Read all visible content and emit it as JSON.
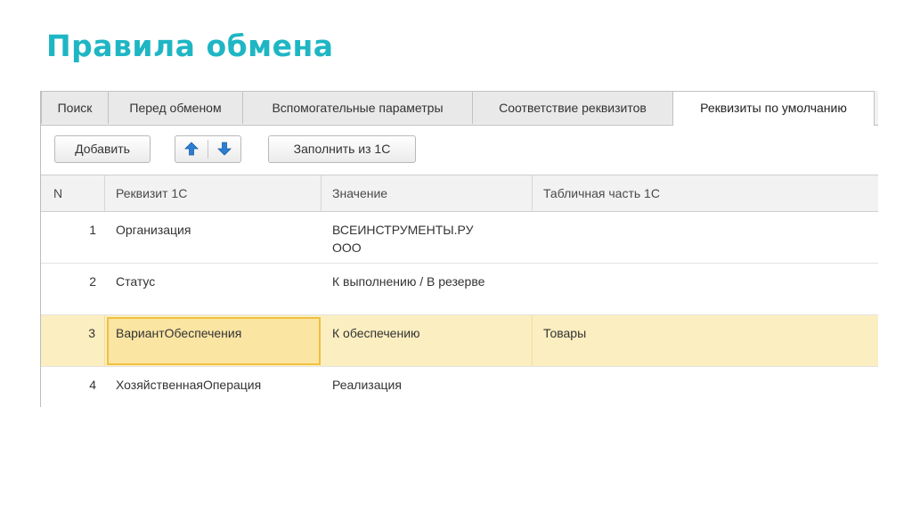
{
  "slide": {
    "title": "Правила обмена"
  },
  "tabs": [
    {
      "label": "Поиск",
      "active": false
    },
    {
      "label": "Перед обменом",
      "active": false
    },
    {
      "label": "Вспомогательные параметры",
      "active": false
    },
    {
      "label": "Соответствие реквизитов",
      "active": false
    },
    {
      "label": "Реквизиты по умолчанию",
      "active": true
    }
  ],
  "toolbar": {
    "add_label": "Добавить",
    "move_up_icon": "arrow-up-icon",
    "move_down_icon": "arrow-down-icon",
    "fill_label": "Заполнить из 1С",
    "arrow_color": "#2a7fd4"
  },
  "table": {
    "columns": [
      "N",
      "Реквизит 1С",
      "Значение",
      "Табличная часть 1С"
    ],
    "rows": [
      {
        "n": "1",
        "attribute": "Организация",
        "value_line1": "ВСЕИНСТРУМЕНТЫ.РУ",
        "value_line2": "ООО",
        "table_part": "",
        "selected": false
      },
      {
        "n": "2",
        "attribute": "Статус",
        "value_line1": "К выполнению / В резерве",
        "value_line2": "",
        "table_part": "",
        "selected": false
      },
      {
        "n": "3",
        "attribute": "ВариантОбеспечения",
        "value_line1": "К обеспечению",
        "value_line2": "",
        "table_part": "Товары",
        "selected": true
      },
      {
        "n": "4",
        "attribute": "ХозяйственнаяОперация",
        "value_line1": "Реализация",
        "value_line2": "",
        "table_part": "",
        "selected": false
      }
    ]
  },
  "colors": {
    "title": "#1fb6c4",
    "selected_row": "#fbeec0",
    "focused_cell_border": "#f0c040"
  }
}
